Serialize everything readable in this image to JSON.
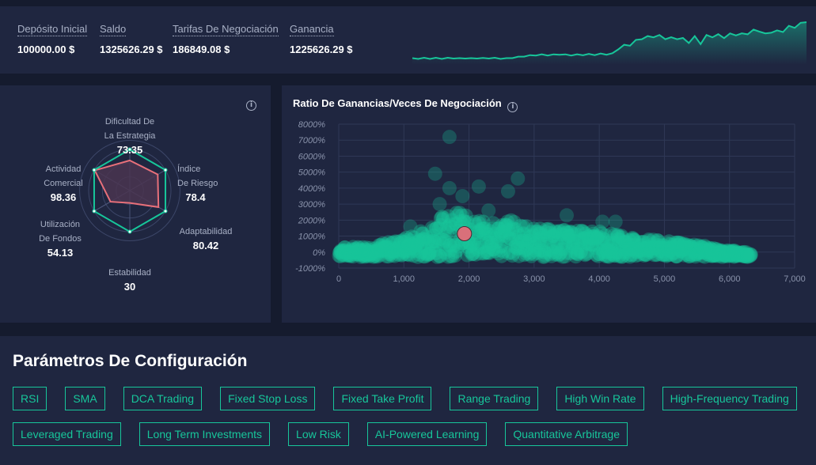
{
  "summary": {
    "stats": [
      {
        "label": "Depósito Inicial",
        "value": "100000.00 $"
      },
      {
        "label": "Saldo",
        "value": "1325626.29 $"
      },
      {
        "label": "Tarifas De Negociación",
        "value": "186849.08 $"
      },
      {
        "label": "Ganancia",
        "value": "1225626.29 $"
      }
    ],
    "equity_curve": [
      0,
      0,
      0.01,
      0,
      0.01,
      0,
      0.01,
      0.01,
      0,
      0.01,
      0,
      0.01,
      0.005,
      0.01,
      0.01,
      0,
      0,
      0.02,
      0.04,
      0.06,
      0.08,
      0.09,
      0.1,
      0.09,
      0.1,
      0.11,
      0.1,
      0.09,
      0.1,
      0.095,
      0.11,
      0.1,
      0.12,
      0.11,
      0.13,
      0.25,
      0.32,
      0.38,
      0.45,
      0.55,
      0.55,
      0.6,
      0.58,
      0.55,
      0.52,
      0.55,
      0.5,
      0.45,
      0.55,
      0.42,
      0.58,
      0.6,
      0.6,
      0.58,
      0.62,
      0.65,
      0.62,
      0.68,
      0.72,
      0.75,
      0.62,
      0.72,
      0.7,
      0.74,
      0.82,
      0.85,
      0.9,
      1.0
    ]
  },
  "radar": {
    "info_icon": "info-icon",
    "axes": [
      {
        "label1": "Dificultad De",
        "label2": "La Estrategia",
        "value": 73.35,
        "display": "73.35"
      },
      {
        "label1": "Índice",
        "label2": "De Riesgo",
        "value": 78.4,
        "display": "78.4"
      },
      {
        "label1": "Adaptabilidad",
        "label2": "",
        "value": 80.42,
        "display": "80.42"
      },
      {
        "label1": "Estabilidad",
        "label2": "",
        "value": 30,
        "display": "30"
      },
      {
        "label1": "Utilización",
        "label2": "De Fondos",
        "value": 54.13,
        "display": "54.13"
      },
      {
        "label1": "Actividad",
        "label2": "Comercial",
        "value": 98.36,
        "display": "98.36"
      }
    ],
    "max": 100,
    "colors": {
      "outline": "#17c69a",
      "value": "#e8707a",
      "fill": "#4a3550"
    }
  },
  "scatter": {
    "title": "Ratio De Ganancias/Veces De Negociación",
    "info_icon": "info-icon"
  },
  "chart_data": {
    "type": "scatter",
    "title": "Ratio De Ganancias/Veces De Negociación",
    "xlabel": "",
    "ylabel": "",
    "xlim": [
      0,
      7000
    ],
    "ylim": [
      -1000,
      8000
    ],
    "x_ticks": [
      "0",
      "1,000",
      "2,000",
      "3,000",
      "4,000",
      "5,000",
      "6,000",
      "7,000"
    ],
    "y_ticks": [
      "8000%",
      "7000%",
      "6000%",
      "5000%",
      "4000%",
      "3000%",
      "2000%",
      "1000%",
      "0%",
      "-1000%"
    ],
    "grid": true,
    "series": [
      {
        "name": "strategies",
        "color": "#17c69a",
        "outliers": [
          [
            1700,
            7200
          ],
          [
            1480,
            4900
          ],
          [
            1700,
            4000
          ],
          [
            1900,
            3500
          ],
          [
            2150,
            4100
          ],
          [
            2600,
            3800
          ],
          [
            2750,
            4600
          ],
          [
            1550,
            3000
          ],
          [
            2300,
            2600
          ],
          [
            3500,
            2300
          ],
          [
            4050,
            1900
          ],
          [
            4250,
            1900
          ],
          [
            1100,
            1600
          ]
        ],
        "envelope": [
          [
            0,
            300
          ],
          [
            500,
            400
          ],
          [
            1000,
            900
          ],
          [
            1400,
            1700
          ],
          [
            1700,
            2800
          ],
          [
            2000,
            2200
          ],
          [
            2300,
            1800
          ],
          [
            2600,
            2100
          ],
          [
            3000,
            1500
          ],
          [
            3500,
            1400
          ],
          [
            4000,
            1300
          ],
          [
            4500,
            900
          ],
          [
            5000,
            700
          ],
          [
            5500,
            500
          ],
          [
            5800,
            200
          ],
          [
            6300,
            0
          ]
        ]
      },
      {
        "name": "current strategy",
        "color": "#d9707a",
        "points": [
          [
            1930,
            1150
          ]
        ]
      }
    ]
  },
  "config": {
    "title": "Parámetros De Configuración",
    "tags_row1": [
      "RSI",
      "SMA",
      "DCA Trading",
      "Fixed Stop Loss",
      "Fixed Take Profit",
      "Range Trading",
      "High Win Rate",
      "High-Frequency Trading"
    ],
    "tags_row2": [
      "Leveraged Trading",
      "Long Term Investments",
      "Low Risk",
      "AI-Powered Learning",
      "Quantitative Arbitrage"
    ]
  },
  "colors": {
    "accent": "#17c69a",
    "panel": "#1f2640",
    "background": "#151b2e",
    "highlight": "#d9707a"
  }
}
